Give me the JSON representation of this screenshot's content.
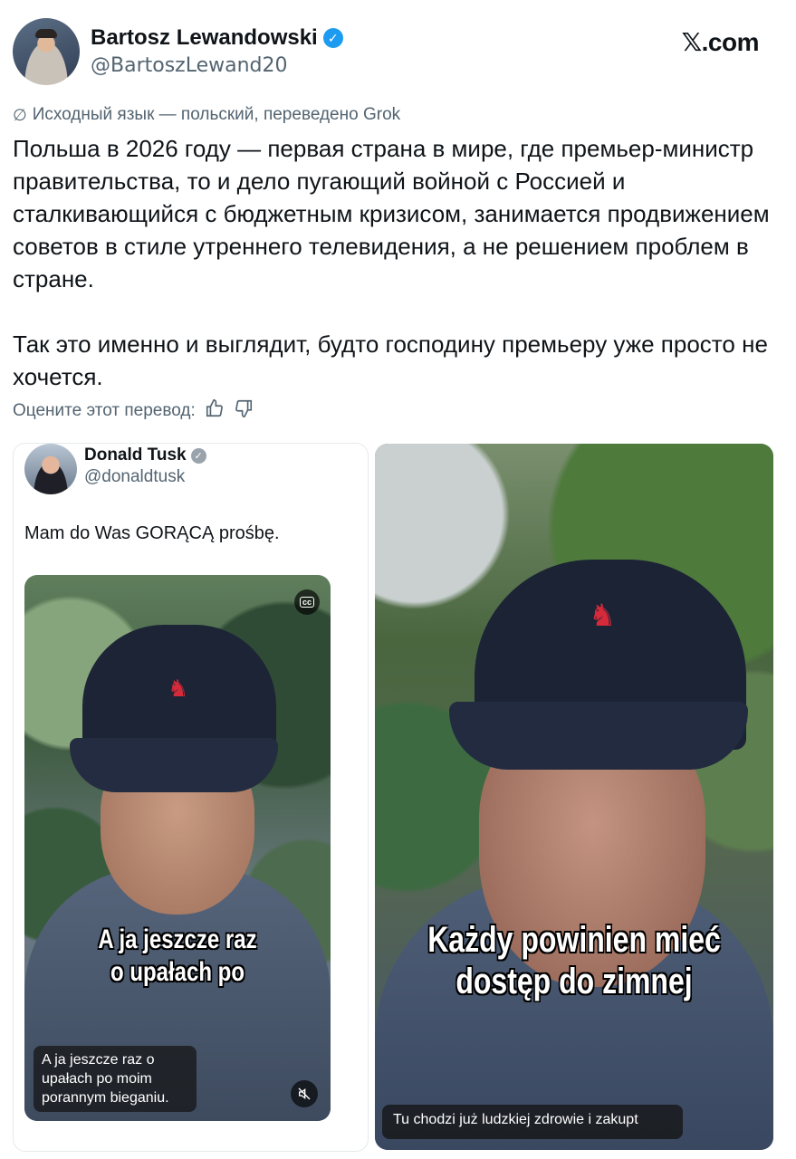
{
  "author": {
    "name": "Bartosz Lewandowski",
    "handle": "@BartoszLewand20",
    "verified_mark": "✓"
  },
  "brand": {
    "prefix": "𝕏",
    "suffix": ".com"
  },
  "translation_note": "Исходный язык — польский, переведено Grok",
  "tweet": {
    "paragraph1": "Польша в 2026 году — первая страна в мире, где премьер-министр правительства, то и дело пугающий войной с Россией и сталкивающийся с бюджетным кризисом, занимается продвижением советов в стиле утреннего телевидения, а не решением проблем в стране.",
    "paragraph2": "Так это именно и выглядит, будто господину премьеру уже просто не хочется."
  },
  "rate": {
    "label": "Оцените этот перевод:",
    "like_icon": "thumbs-up-icon",
    "dislike_icon": "thumbs-down-icon"
  },
  "quoted": {
    "name": "Donald Tusk",
    "handle": "@donaldtusk",
    "badge_mark": "✓",
    "text": "Mam do Was GORĄCĄ prośbę.",
    "video_caption_line1": "A ja jeszcze raz",
    "video_caption_line2": "o upałach po",
    "subtitle": "A ja jeszcze raz o upałach po moim porannym bieganiu.",
    "cc_label": "cc",
    "mute_icon": "speaker-muted-icon"
  },
  "media_right": {
    "caption_line1": "Każdy powinien mieć",
    "caption_line2": "dostęp do zimnej",
    "subtitle": "Tu chodzi już ludzkiej zdrowie i zakupt"
  },
  "colors": {
    "text": "#0f1419",
    "muted": "#536471",
    "verified": "#1d9bf0",
    "cap": "#1c2436",
    "logo_red": "#d42a3a"
  }
}
